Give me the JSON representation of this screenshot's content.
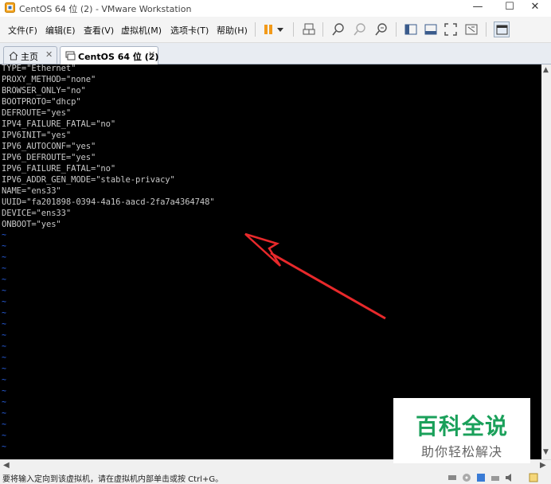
{
  "window": {
    "title": "CentOS 64 位 (2) - VMware Workstation",
    "minimize": "—",
    "maximize": "☐",
    "close": "✕"
  },
  "menu": [
    "文件(F)",
    "编辑(E)",
    "查看(V)",
    "虚拟机(M)",
    "选项卡(T)",
    "帮助(H)"
  ],
  "tabs": [
    {
      "label": "主页",
      "close": "✕"
    },
    {
      "label": "CentOS 64 位 (2)",
      "close": "✕"
    }
  ],
  "console": {
    "lines": [
      "TYPE=\"Ethernet\"",
      "PROXY_METHOD=\"none\"",
      "BROWSER_ONLY=\"no\"",
      "BOOTPROTO=\"dhcp\"",
      "DEFROUTE=\"yes\"",
      "IPV4_FAILURE_FATAL=\"no\"",
      "IPV6INIT=\"yes\"",
      "IPV6_AUTOCONF=\"yes\"",
      "IPV6_DEFROUTE=\"yes\"",
      "IPV6_FAILURE_FATAL=\"no\"",
      "IPV6_ADDR_GEN_MODE=\"stable-privacy\"",
      "NAME=\"ens33\"",
      "UUID=\"fa201898-0394-4a16-aacd-2fa7a4364748\"",
      "DEVICE=\"ens33\"",
      "ONBOOT=\"yes\""
    ],
    "tilde": "~"
  },
  "status": {
    "text": "要将输入定向到该虚拟机，请在虚拟机内部单击或按 Ctrl+G。"
  },
  "watermark": {
    "main": "百科全说",
    "sub": "助你轻松解决"
  },
  "colors": {
    "accent": "#e8292b",
    "console_bg": "#000000",
    "console_text": "#c8c8c8",
    "tilde": "#2e6cff",
    "watermark_green": "#1aa05a"
  }
}
